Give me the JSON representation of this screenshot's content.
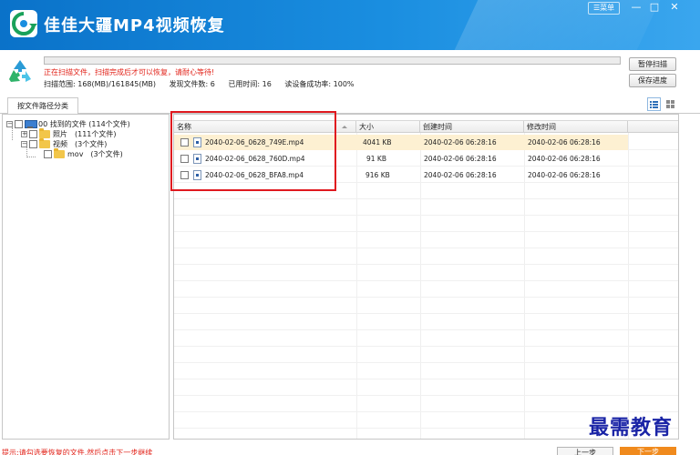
{
  "app": {
    "title": "佳佳大疆MP4视频恢复"
  },
  "window": {
    "menu_label": "☰菜单",
    "minimize": "—",
    "maximize": "□",
    "close": "✕"
  },
  "scan": {
    "progress_percent": 0,
    "message": "正在扫描文件，扫描完成后才可以恢复，请耐心等待!",
    "range": "扫描范围: 168(MB)/161845(MB)",
    "found": "发现文件数: 6",
    "elapsed": "已用时间: 16",
    "read_success": "读设备成功率: 100%",
    "pause_label": "暂停扫描",
    "save_label": "保存进度"
  },
  "tabs": {
    "active": "按文件路径分类"
  },
  "tree": {
    "root": "00 找到的文件 (114个文件)",
    "items": [
      {
        "label": "照片",
        "count": "(111个文件)"
      },
      {
        "label": "视频",
        "count": "(3个文件)"
      },
      {
        "label": "mov",
        "count": "(3个文件)"
      }
    ]
  },
  "table": {
    "headers": {
      "name": "名称",
      "size": "大小",
      "created": "创建时间",
      "modified": "修改时间"
    },
    "rows": [
      {
        "name": "2040-02-06_0628_749E.mp4",
        "size": "4041 KB",
        "created": "2040-02-06  06:28:16",
        "modified": "2040-02-06  06:28:16"
      },
      {
        "name": "2040-02-06_0628_760D.mp4",
        "size": "91 KB",
        "created": "2040-02-06  06:28:16",
        "modified": "2040-02-06  06:28:16"
      },
      {
        "name": "2040-02-06_0628_BFA8.mp4",
        "size": "916 KB",
        "created": "2040-02-06  06:28:16",
        "modified": "2040-02-06  06:28:16"
      }
    ]
  },
  "footer": {
    "message": "提示:请勾选要恢复的文件,然后点击下一步继续",
    "prev_label": "上一步",
    "next_label": "下一步"
  },
  "watermark": "最需教育",
  "colors": {
    "title_bar": "#1a8ee0",
    "highlight_row": "#fdf0d2",
    "annotation_box": "#e0191f",
    "next_button": "#f08a1d",
    "watermark": "#1a24a6"
  }
}
